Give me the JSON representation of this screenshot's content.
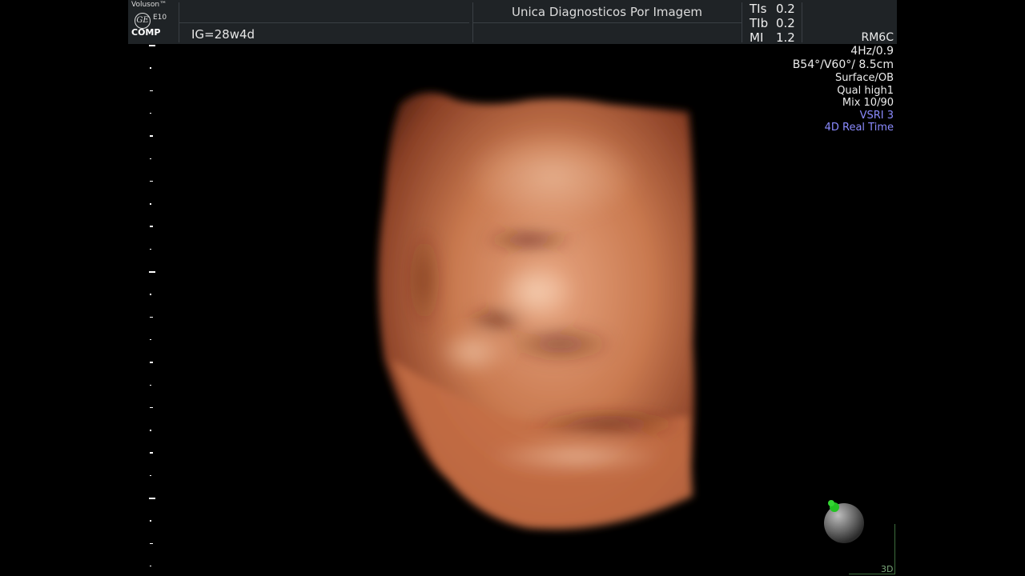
{
  "header": {
    "brand": "Voluson™",
    "model": "E10",
    "logo_initials": "GE",
    "mode": "COMP",
    "gestational_age": "IG=28w4d",
    "clinic_name": "Unica Diagnosticos Por Imagem"
  },
  "thermal_indices": [
    {
      "label": "TIs",
      "value": "0.2"
    },
    {
      "label": "TIb",
      "value": "0.2"
    },
    {
      "label": "MI",
      "value": "1.2"
    }
  ],
  "probe_params": {
    "probe": "RM6C",
    "frame_rate": "4Hz/0.9",
    "angles_depth": "B54°/V60°/ 8.5cm",
    "render_mode": "Surface/OB",
    "quality": "Qual high1",
    "mix": "Mix 10/90",
    "vsri": "VSRI 3",
    "realtime_mode": "4D Real Time"
  },
  "orientation": {
    "label": "3D",
    "marker_color": "#22c322"
  },
  "colors": {
    "accent_blue": "#8b8bff",
    "skin_tone": "#c9794f",
    "background": "#000000"
  }
}
